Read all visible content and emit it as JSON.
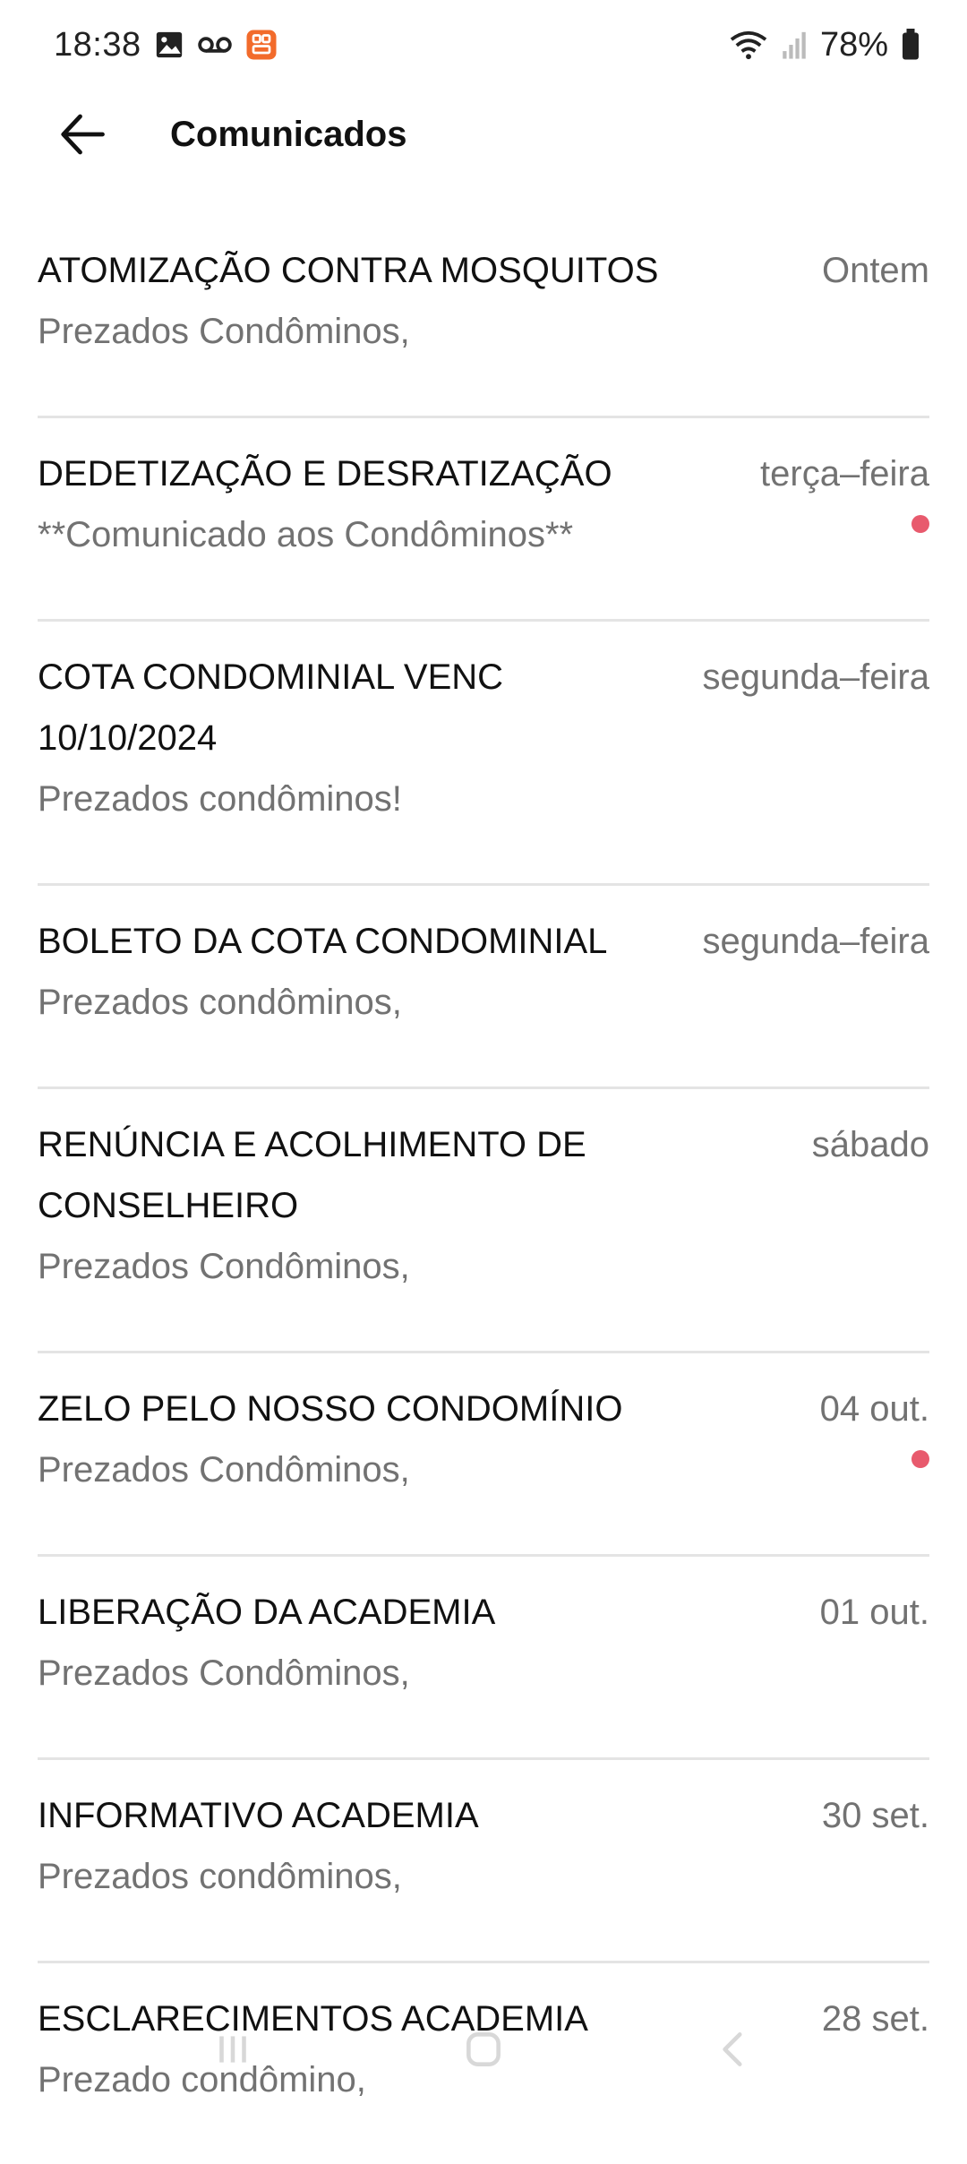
{
  "status_bar": {
    "time": "18:38",
    "battery": "78%",
    "icons": [
      "gallery-icon",
      "voicemail-icon",
      "app-notification-icon",
      "wifi-icon",
      "signal-icon",
      "battery-icon"
    ]
  },
  "header": {
    "title": "Comunicados",
    "back_icon": "arrow-left-icon"
  },
  "messages": [
    {
      "title": "ATOMIZAÇÃO CONTRA MOSQUITOS",
      "preview": "Prezados Condôminos,",
      "date": "Ontem",
      "unread": false
    },
    {
      "title": "DEDETIZAÇÃO E DESRATIZAÇÃO",
      "preview": "**Comunicado aos Condôminos**",
      "date": "terça–feira",
      "unread": true
    },
    {
      "title": "COTA CONDOMINIAL VENC 10/10/2024",
      "preview": "Prezados condôminos!",
      "date": "segunda–feira",
      "unread": false
    },
    {
      "title": "BOLETO DA COTA CONDOMINIAL",
      "preview": "Prezados condôminos,",
      "date": "segunda–feira",
      "unread": false
    },
    {
      "title": "RENÚNCIA E ACOLHIMENTO DE CONSELHEIRO",
      "preview": "Prezados Condôminos,",
      "date": "sábado",
      "unread": false
    },
    {
      "title": "ZELO PELO NOSSO CONDOMÍNIO",
      "preview": "Prezados Condôminos,",
      "date": "04 out.",
      "unread": true
    },
    {
      "title": "LIBERAÇÃO DA ACADEMIA",
      "preview": "Prezados Condôminos,",
      "date": "01 out.",
      "unread": false
    },
    {
      "title": "INFORMATIVO ACADEMIA",
      "preview": "Prezados condôminos,",
      "date": "30 set.",
      "unread": false
    },
    {
      "title": "ESCLARECIMENTOS ACADEMIA",
      "preview": "Prezado condômino,",
      "date": "28 set.",
      "unread": false
    }
  ],
  "colors": {
    "unread_dot": "#e85a6d",
    "secondary_text": "#727272",
    "divider": "#e4e4e4"
  },
  "nav_bar": {
    "icons": [
      "recent-apps-icon",
      "home-icon",
      "back-nav-icon"
    ]
  }
}
